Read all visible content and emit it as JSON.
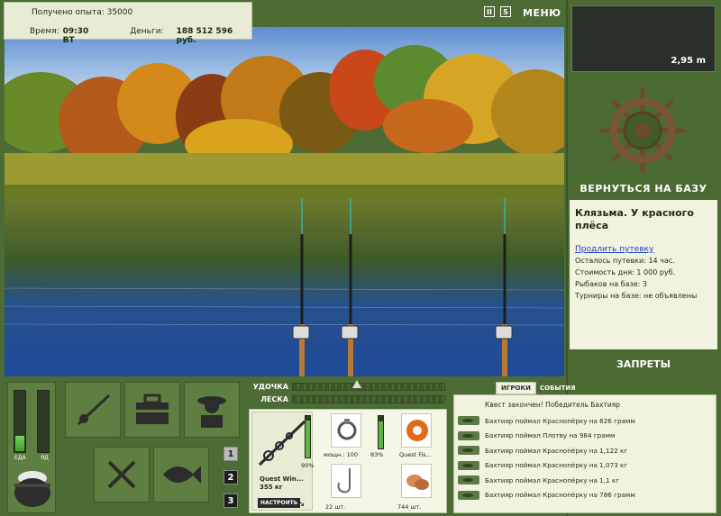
{
  "header": {
    "exp_label": "Получено опыта: 35000",
    "time_label": "Время:",
    "time_value": "09:30 ВТ",
    "money_label": "Деньги:",
    "money_value": "188 512 596 руб."
  },
  "controls": {
    "pause": "II",
    "sound": "S",
    "menu": "МЕНЮ"
  },
  "depth": {
    "value": "2,95 m"
  },
  "base": {
    "return_label": "ВЕРНУТЬСЯ НА БАЗУ",
    "bans_label": "ЗАПРЕТЫ"
  },
  "location": {
    "title": "Клязьма. У красного плёса",
    "extend_link": "Продлить путевку",
    "info": [
      "Осталось путевки: 14 час.",
      "Стоимость дня: 1 000 руб.",
      "Рыбаков на базе: 3",
      "Турниры на базе: не объявлены"
    ]
  },
  "meters": {
    "food_label": "ЕДА",
    "poison_label": "ЯД",
    "food_level": 0.25,
    "poison_level": 0.0
  },
  "pages": [
    "1",
    "2",
    "3"
  ],
  "tension": {
    "rod_label": "УДОЧКА",
    "line_label": "ЛЕСКА",
    "rod_level": 0.42
  },
  "gear": {
    "rod_name": "Quest Win...",
    "rod_weight": "355 кг",
    "rod_pct": "90%",
    "adjust_label": "НАСТРОИТЬ",
    "reel_power": "мощн.: 100",
    "reel_pct": "83%",
    "line_name": "Quest Fis...",
    "hooks_count": "22 шт.",
    "bait_count": "744 шт."
  },
  "events": {
    "tab_players": "ИГРОКИ",
    "tab_events": "СОБЫТИЯ",
    "quest_line": "Квест закончен! Победитель Бахтияр",
    "items": [
      "Бахтияр поймал Краснопёрку на 626 грамм",
      "Бахтияр поймал Плотву на 984 грамм",
      "Бахтияр поймал Краснопёрку на 1,122 кг",
      "Бахтияр поймал Краснопёрку на 1,073 кг",
      "Бахтияр поймал Краснопёрку на 1,1 кг",
      "Бахтияр поймал Краснопёрку на 786 грамм"
    ]
  }
}
